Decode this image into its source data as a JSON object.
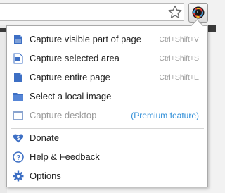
{
  "browser": {
    "bookmark_icon": "star-outline-icon",
    "extension_icon": "awesome-screenshot-lens-icon"
  },
  "menu": {
    "capture_items": [
      {
        "label": "Capture visible part of page",
        "shortcut": "Ctrl+Shift+V",
        "icon": "page-visible-icon"
      },
      {
        "label": "Capture selected area",
        "shortcut": "Ctrl+Shift+S",
        "icon": "selection-icon"
      },
      {
        "label": "Capture entire page",
        "shortcut": "Ctrl+Shift+E",
        "icon": "page-entire-icon"
      },
      {
        "label": "Select a local image",
        "shortcut": "",
        "icon": "folder-icon"
      }
    ],
    "capture_desktop": {
      "label": "Capture desktop",
      "premium": "(Premium feature)",
      "icon": "desktop-window-icon"
    },
    "bottom_items": [
      {
        "label": "Donate",
        "icon": "heart-dollar-icon"
      },
      {
        "label": "Help & Feedback",
        "icon": "help-icon"
      },
      {
        "label": "Options",
        "icon": "gear-icon"
      }
    ]
  },
  "colors": {
    "icon_blue": "#3d6fc4",
    "premium_link": "#2f8ed8",
    "disabled_text": "#9a9a9a"
  }
}
